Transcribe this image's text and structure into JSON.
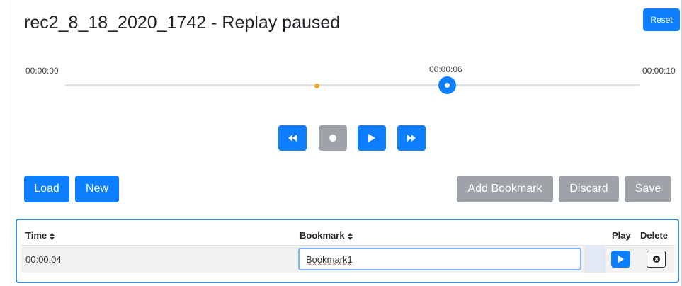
{
  "header": {
    "title": "rec2_8_18_2020_1742 - Replay paused",
    "reset_label": "Reset"
  },
  "timeline": {
    "start_time": "00:00:00",
    "current_time": "00:00:06",
    "end_time": "00:00:10",
    "current_seconds": 6,
    "total_seconds": 10,
    "bookmark_seconds": [
      4
    ]
  },
  "controls": {
    "rewind_icon": "rewind-icon",
    "record_icon": "record-icon",
    "play_icon": "play-icon",
    "forward_icon": "fast-forward-icon"
  },
  "actions": {
    "load_label": "Load",
    "new_label": "New",
    "add_bookmark_label": "Add Bookmark",
    "discard_label": "Discard",
    "save_label": "Save"
  },
  "table": {
    "columns": {
      "time": "Time",
      "bookmark": "Bookmark",
      "play": "Play",
      "delete": "Delete"
    },
    "rows": [
      {
        "time": "00:00:04",
        "bookmark": "Bookmark1"
      }
    ]
  },
  "colors": {
    "primary": "#0d7efe",
    "secondary": "#9da3a9",
    "bookmark_marker": "#f5a623",
    "table_border": "#3d8bcd"
  }
}
